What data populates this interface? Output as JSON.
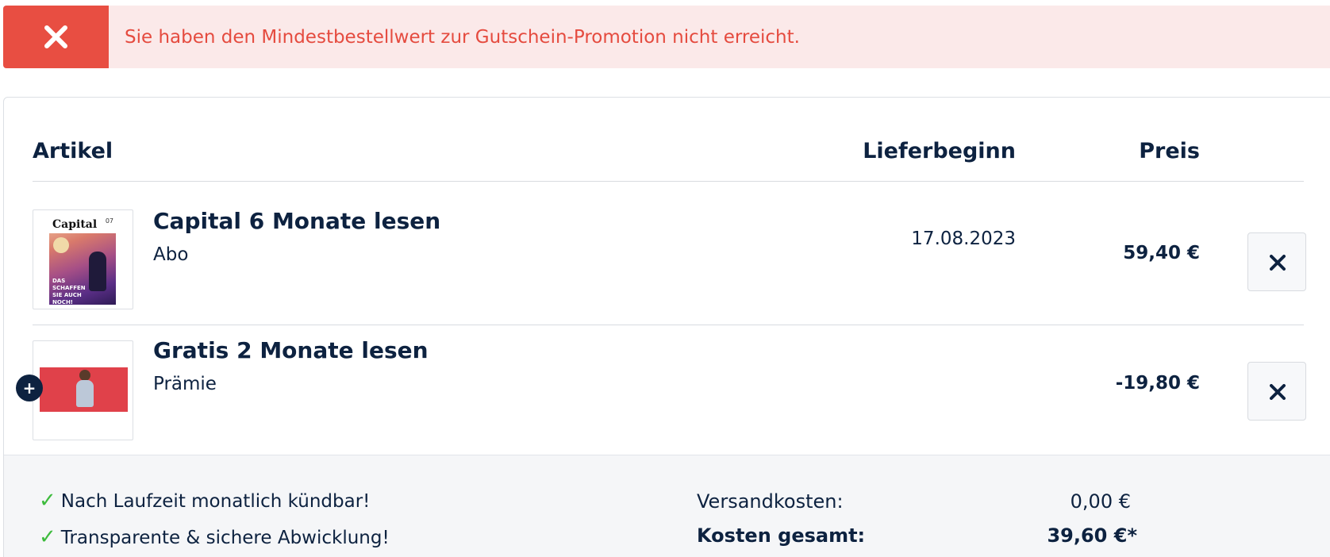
{
  "alert": {
    "icon": "close-icon",
    "message": "Sie haben den Mindestbestellwert zur Gutschein-Promotion nicht erreicht.",
    "colors": {
      "background": "#fbe9e9",
      "icon_box": "#e84e42",
      "text": "#e54b3f"
    }
  },
  "table": {
    "headers": {
      "artikel": "Artikel",
      "lieferbeginn": "Lieferbeginn",
      "preis": "Preis"
    },
    "items": [
      {
        "title": "Capital 6 Monate lesen",
        "subtitle": "Abo",
        "lieferbeginn": "17.08.2023",
        "price": "59,40 €",
        "image": "capital-magazine-cover",
        "cover_logo": "Capital",
        "cover_issue": "07",
        "cover_tagline": "DAS SCHAFFEN SIE AUCH NOCH!",
        "remove_icon": "close-icon"
      },
      {
        "title": "Gratis 2 Monate lesen",
        "subtitle": "Prämie",
        "lieferbeginn": "",
        "price": "-19,80 €",
        "image": "promo-person-red-background",
        "expand_icon": "plus-icon",
        "remove_icon": "close-icon"
      }
    ]
  },
  "footer": {
    "features": [
      {
        "icon": "check-icon",
        "text": "Nach Laufzeit monatlich kündbar!"
      },
      {
        "icon": "check-icon",
        "text": "Transparente & sichere Abwicklung!"
      }
    ],
    "summary": {
      "shipping_label": "Versandkosten:",
      "shipping_value": "0,00 €",
      "total_label": "Kosten gesamt:",
      "total_value": "39,60 €*"
    }
  },
  "colors": {
    "text": "#0d2240",
    "check": "#3dbb3d",
    "footer_bg": "#f5f6f8"
  }
}
